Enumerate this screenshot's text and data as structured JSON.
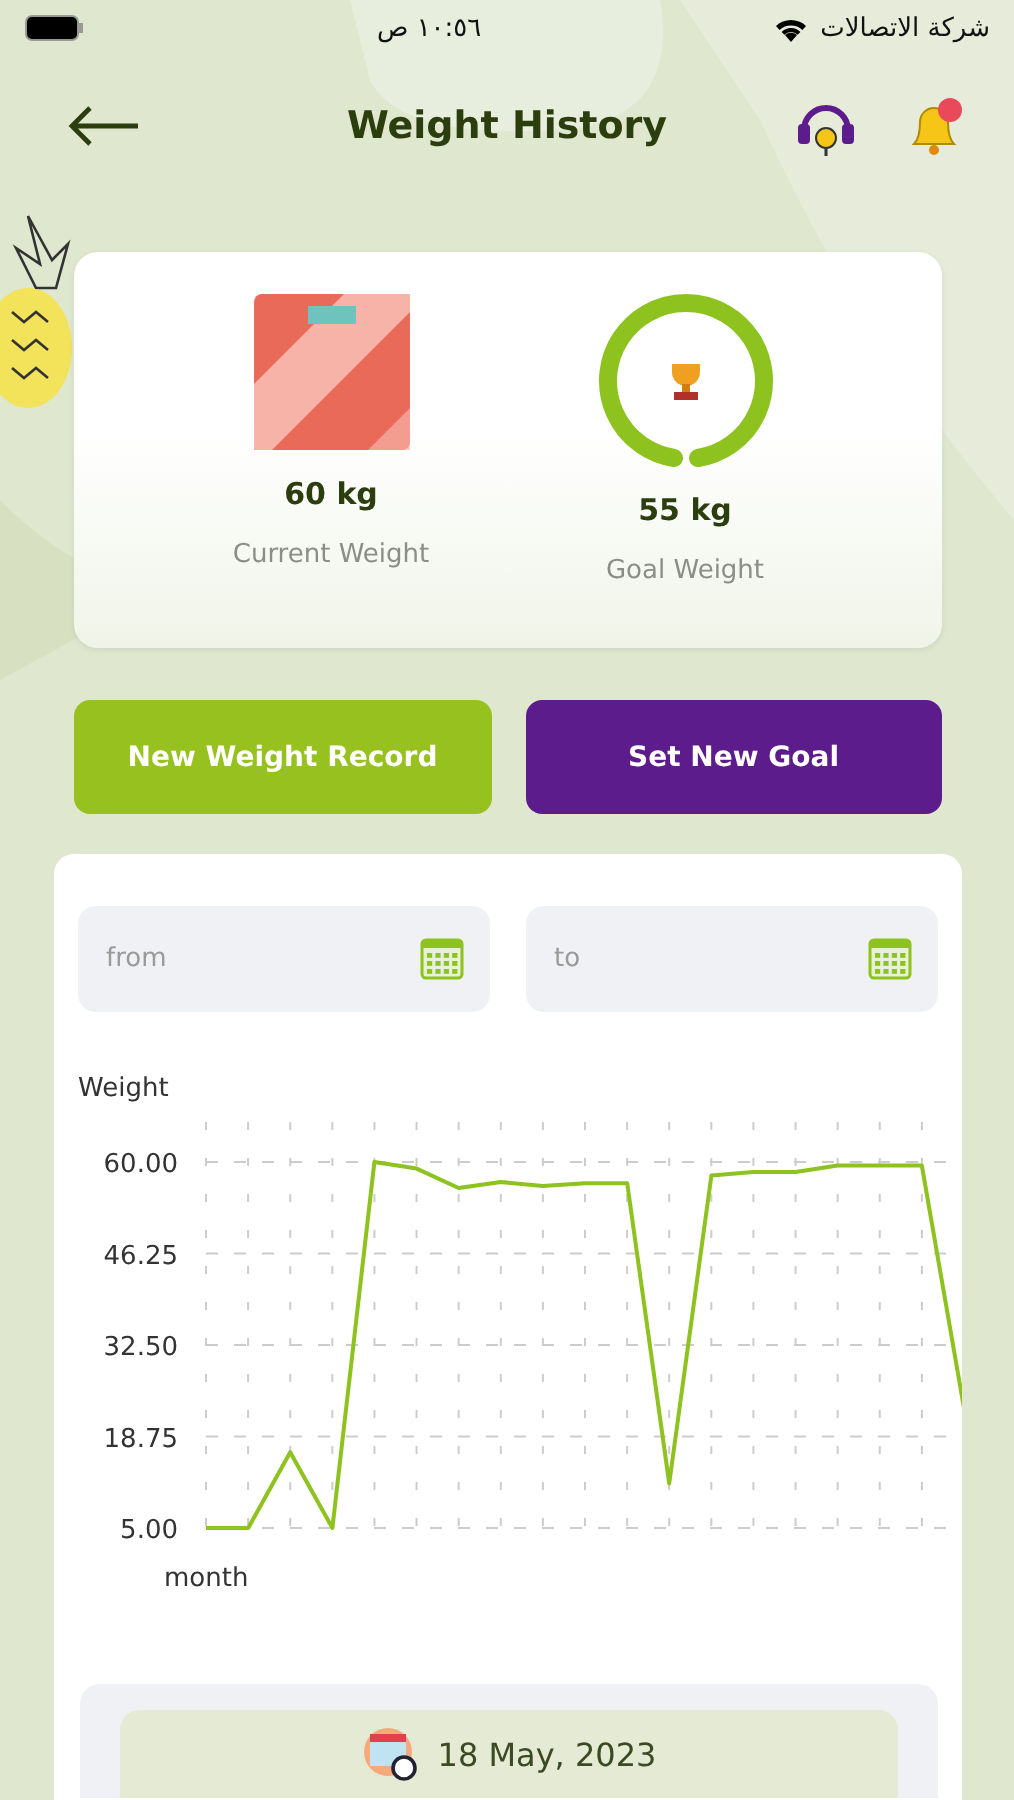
{
  "status_bar": {
    "carrier": "شركة الاتصالات",
    "time": "١٠:٥٦ ص"
  },
  "header": {
    "title": "Weight History"
  },
  "summary": [
    {
      "kind": "scale",
      "value": "60 kg",
      "label": "Current Weight"
    },
    {
      "kind": "goal",
      "value": "55 kg",
      "label": "Goal Weight"
    }
  ],
  "buttons": [
    {
      "label": "New Weight Record",
      "kind": "primary"
    },
    {
      "label": "Set New Goal",
      "kind": "secondary"
    }
  ],
  "filters": [
    {
      "placeholder": "from"
    },
    {
      "placeholder": "to"
    }
  ],
  "chart_data": {
    "type": "line",
    "ylabel": "Weight",
    "xlabel": "month",
    "ylim": [
      5,
      60
    ],
    "grid": true,
    "yticks": [
      {
        "value": 5,
        "label": "5.00"
      },
      {
        "value": 18.75,
        "label": "18.75"
      },
      {
        "value": 32.5,
        "label": "32.50"
      },
      {
        "value": 46.25,
        "label": "46.25"
      },
      {
        "value": 60,
        "label": "60.00"
      }
    ],
    "values": [
      5,
      5,
      16.4,
      5,
      60,
      59,
      56.1,
      57,
      56.4,
      56.8,
      56.8,
      11.7,
      58,
      58.5,
      58.5,
      59.5,
      59.5,
      59.5,
      23
    ]
  },
  "entry": {
    "date": "18 May, 2023"
  }
}
